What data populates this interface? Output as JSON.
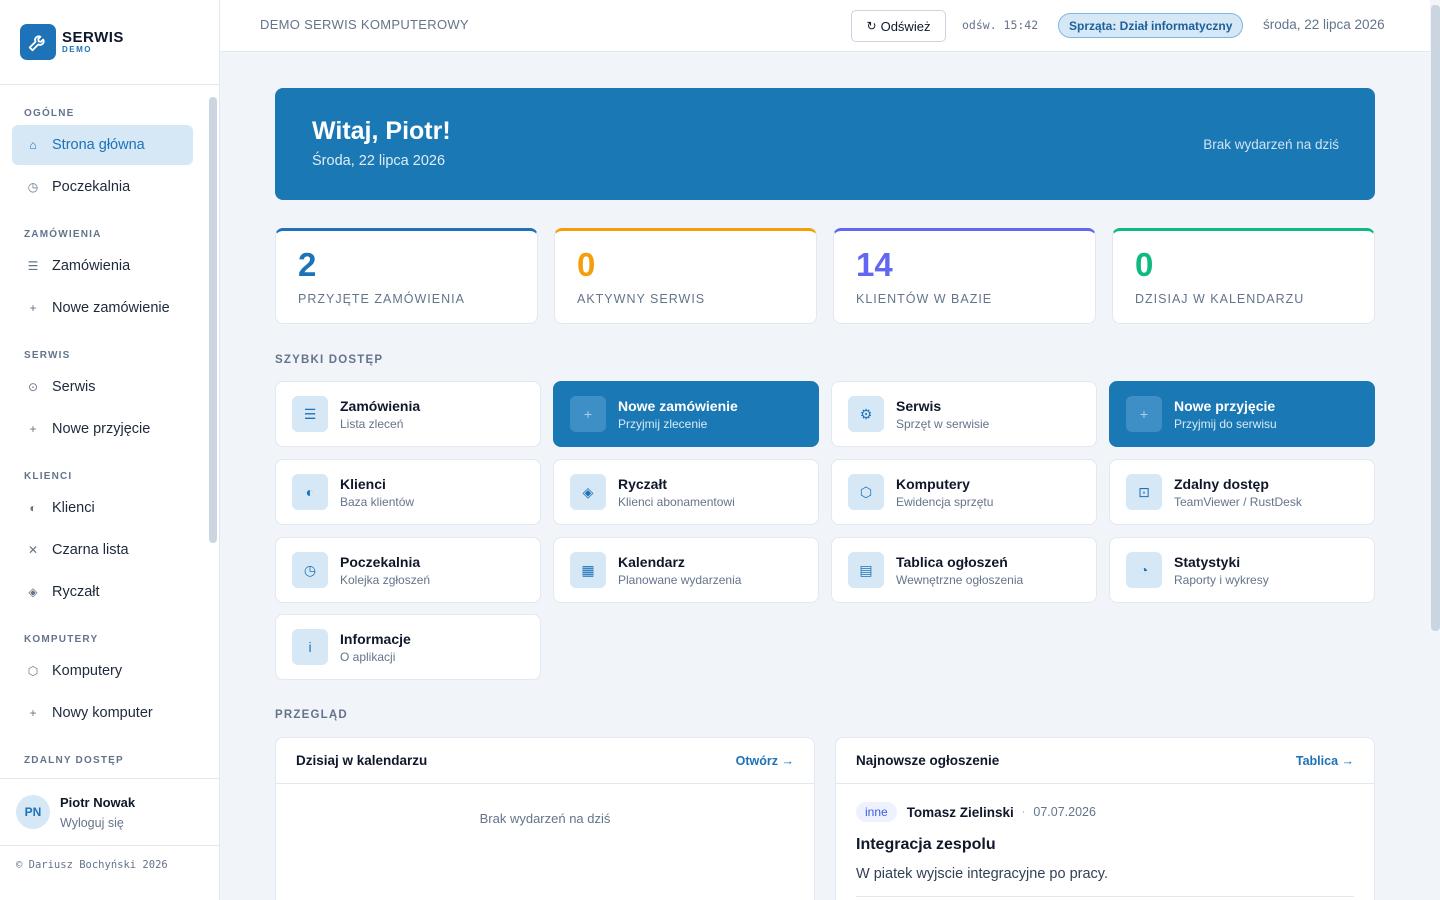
{
  "logo": {
    "title": "SERWIS",
    "subtitle": "DEMO",
    "icon": "wrench-icon"
  },
  "sidebar": {
    "sections": [
      {
        "label": "OGÓLNE",
        "items": [
          {
            "label": "Strona główna",
            "icon": "⌂",
            "name": "home",
            "active": true
          },
          {
            "label": "Poczekalnia",
            "icon": "◷",
            "name": "waiting-room"
          }
        ]
      },
      {
        "label": "ZAMÓWIENIA",
        "items": [
          {
            "label": "Zamówienia",
            "icon": "☰",
            "name": "orders"
          },
          {
            "label": "Nowe zamówienie",
            "icon": "+",
            "name": "new-order"
          }
        ]
      },
      {
        "label": "SERWIS",
        "items": [
          {
            "label": "Serwis",
            "icon": "⊙",
            "name": "service"
          },
          {
            "label": "Nowe przyjęcie",
            "icon": "+",
            "name": "new-intake"
          }
        ]
      },
      {
        "label": "KLIENCI",
        "items": [
          {
            "label": "Klienci",
            "icon": "◐",
            "name": "clients"
          },
          {
            "label": "Czarna lista",
            "icon": "✕",
            "name": "blacklist"
          },
          {
            "label": "Ryczałt",
            "icon": "◈",
            "name": "flat-rate"
          }
        ]
      },
      {
        "label": "KOMPUTERY",
        "items": [
          {
            "label": "Komputery",
            "icon": "⬡",
            "name": "computers"
          },
          {
            "label": "Nowy komputer",
            "icon": "+",
            "name": "new-computer"
          }
        ]
      },
      {
        "label": "ZDALNY DOSTĘP",
        "items": []
      }
    ],
    "user": {
      "initials": "PN",
      "name": "Piotr Nowak",
      "logout": "Wyloguj się"
    },
    "copyright": "© Dariusz Bochyński 2026"
  },
  "topbar": {
    "title": "DEMO SERWIS KOMPUTEROWY",
    "refresh_label": "Odśwież",
    "refresh_time": "odśw. 15:42",
    "dept_badge": "Sprząta: Dział informatyczny",
    "date": "środa, 22 lipca 2026"
  },
  "hero": {
    "title": "Witaj, Piotr!",
    "date": "Środa, 22 lipca 2026",
    "right_text": "Brak wydarzeń na dziś"
  },
  "stats": [
    {
      "value": "2",
      "label": "PRZYJĘTE ZAMÓWIENIA",
      "color": "#1d72b8"
    },
    {
      "value": "0",
      "label": "AKTYWNY SERWIS",
      "color": "#f59e0b"
    },
    {
      "value": "14",
      "label": "KLIENTÓW W BAZIE",
      "color": "#6366f1"
    },
    {
      "value": "0",
      "label": "DZISIAJ W KALENDARZU",
      "color": "#10b981"
    }
  ],
  "quick_access": {
    "label": "SZYBKI DOSTĘP",
    "tiles": [
      {
        "title": "Zamówienia",
        "subtitle": "Lista zleceń",
        "icon": "☰",
        "icon_name": "list-icon",
        "primary": false
      },
      {
        "title": "Nowe zamówienie",
        "subtitle": "Przyjmij zlecenie",
        "icon": "+",
        "icon_name": "plus-icon",
        "primary": true
      },
      {
        "title": "Serwis",
        "subtitle": "Sprzęt w serwisie",
        "icon": "⚙",
        "icon_name": "gear-icon",
        "primary": false
      },
      {
        "title": "Nowe przyjęcie",
        "subtitle": "Przyjmij do serwisu",
        "icon": "+",
        "icon_name": "plus-icon",
        "primary": true
      },
      {
        "title": "Klienci",
        "subtitle": "Baza klientów",
        "icon": "◐",
        "icon_name": "clients-icon",
        "primary": false
      },
      {
        "title": "Ryczałt",
        "subtitle": "Klienci abonamentowi",
        "icon": "◈",
        "icon_name": "diamond-icon",
        "primary": false
      },
      {
        "title": "Komputery",
        "subtitle": "Ewidencja sprzętu",
        "icon": "⬡",
        "icon_name": "hexagon-icon",
        "primary": false
      },
      {
        "title": "Zdalny dostęp",
        "subtitle": "TeamViewer / RustDesk",
        "icon": "⊡",
        "icon_name": "remote-icon",
        "primary": false
      },
      {
        "title": "Poczekalnia",
        "subtitle": "Kolejka zgłoszeń",
        "icon": "◷",
        "icon_name": "clock-icon",
        "primary": false
      },
      {
        "title": "Kalendarz",
        "subtitle": "Planowane wydarzenia",
        "icon": "▦",
        "icon_name": "calendar-icon",
        "primary": false
      },
      {
        "title": "Tablica ogłoszeń",
        "subtitle": "Wewnętrzne ogłoszenia",
        "icon": "▤",
        "icon_name": "board-icon",
        "primary": false
      },
      {
        "title": "Statystyki",
        "subtitle": "Raporty i wykresy",
        "icon": "◔",
        "icon_name": "chart-icon",
        "primary": false
      },
      {
        "title": "Informacje",
        "subtitle": "O aplikacji",
        "icon": "i",
        "icon_name": "info-icon",
        "primary": false
      }
    ]
  },
  "overview": {
    "label": "PRZEGLĄD",
    "calendar": {
      "title": "Dzisiaj w kalendarzu",
      "link": "Otwórz →",
      "empty": "Brak wydarzeń na dziś"
    },
    "announcement": {
      "title": "Najnowsze ogłoszenie",
      "link": "Tablica →",
      "tag": "inne",
      "author": "Tomasz Zielinski",
      "date": "07.07.2026",
      "heading": "Integracja zespolu",
      "body": "W piatek wyjscie integracyjne po pracy."
    }
  }
}
